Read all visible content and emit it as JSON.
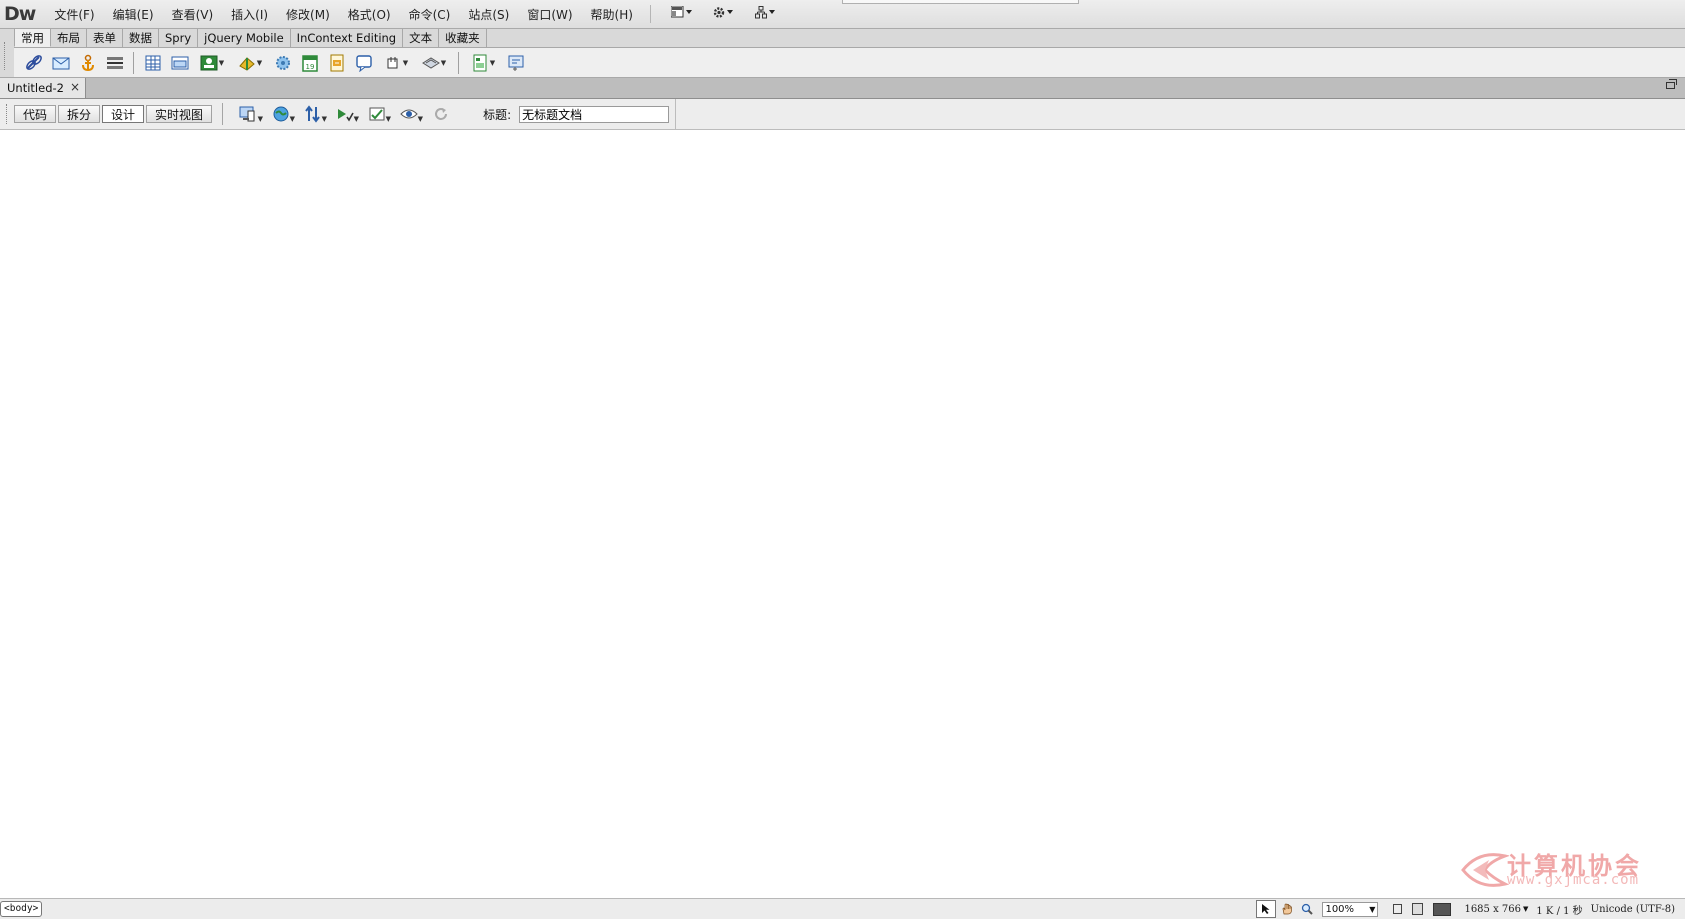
{
  "app": {
    "logo": "Dw"
  },
  "menu": {
    "items": [
      "文件(F)",
      "编辑(E)",
      "查看(V)",
      "插入(I)",
      "修改(M)",
      "格式(O)",
      "命令(C)",
      "站点(S)",
      "窗口(W)",
      "帮助(H)"
    ],
    "icons": [
      "layout-icon",
      "gear-icon",
      "site-icon"
    ]
  },
  "insert_bar": {
    "tabs": [
      "常用",
      "布局",
      "表单",
      "数据",
      "Spry",
      "jQuery Mobile",
      "InContext Editing",
      "文本",
      "收藏夹"
    ],
    "active_tab": "常用",
    "tools": [
      "hyperlink-icon",
      "email-link-icon",
      "named-anchor-icon",
      "horizontal-rule-icon",
      "table-icon",
      "insert-div-icon",
      "images-icon",
      "media-icon",
      "widget-icon",
      "date-icon",
      "server-side-include-icon",
      "comment-icon",
      "head-icon",
      "script-icon",
      "templates-icon",
      "tag-chooser-icon"
    ]
  },
  "document": {
    "tab_name": "Untitled-2",
    "close_glyph": "×"
  },
  "doc_toolbar": {
    "views": [
      "代码",
      "拆分",
      "设计",
      "实时视图"
    ],
    "active_view": "设计",
    "title_label": "标题:",
    "title_value": "无标题文档"
  },
  "status": {
    "tag": "<body>",
    "zoom": "100%",
    "window_size": "1685 x 766",
    "download": "1 K / 1 秒",
    "encoding": "Unicode (UTF-8)"
  },
  "watermark": {
    "title": "计算机协会",
    "url": "www.gxjmca.com"
  }
}
